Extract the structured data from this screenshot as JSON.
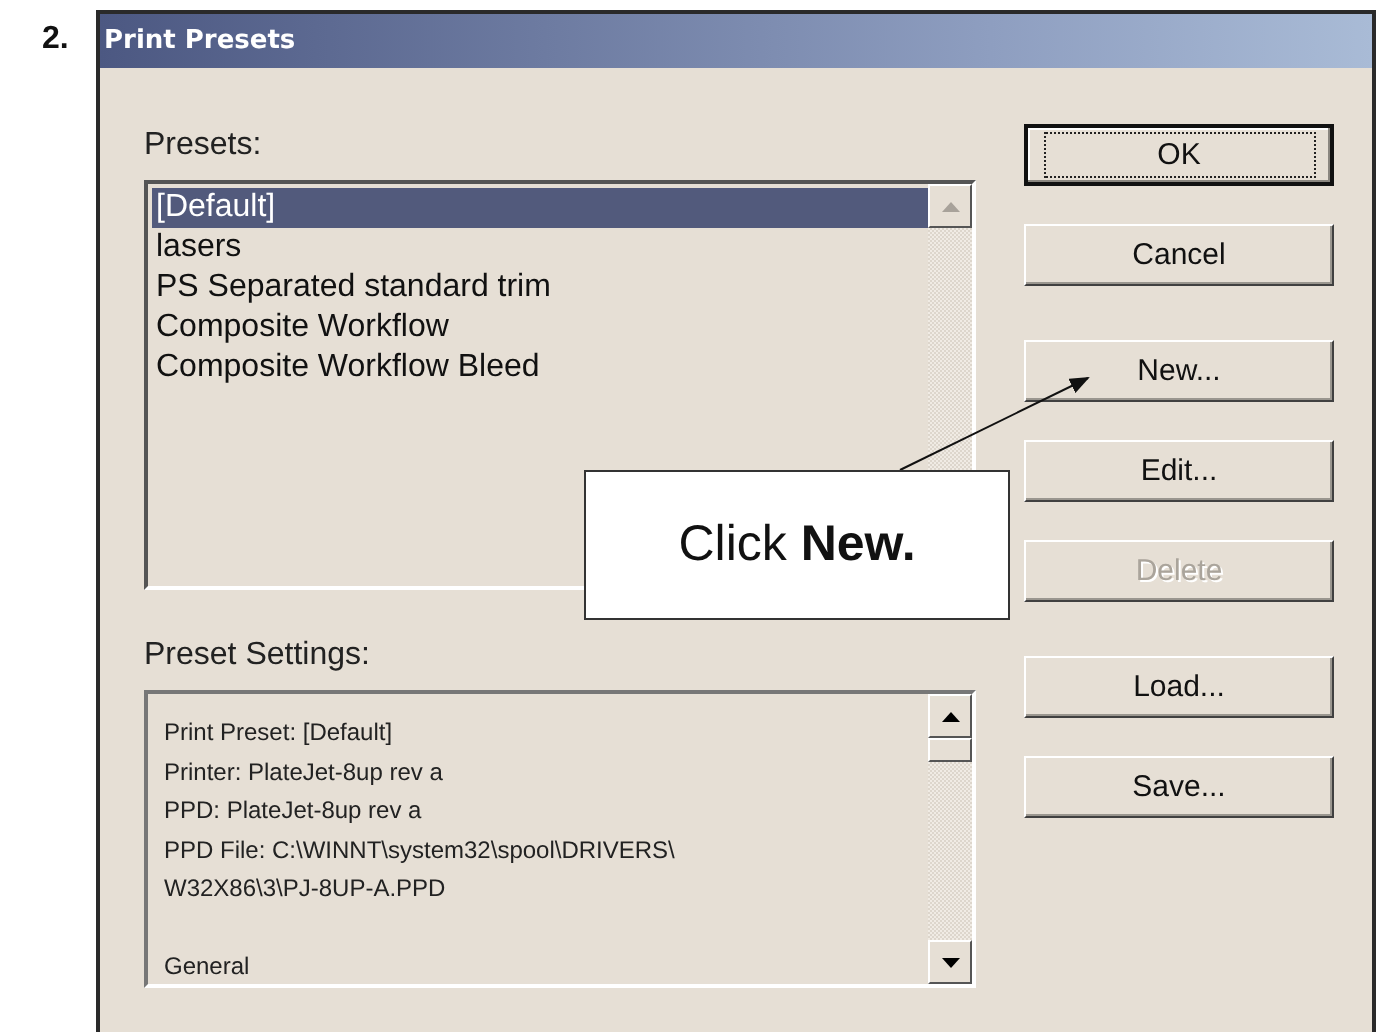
{
  "step": "2.",
  "window": {
    "title": "Print Presets"
  },
  "presets": {
    "label": "Presets:",
    "items": [
      {
        "label": "[Default]",
        "selected": true
      },
      {
        "label": "lasers",
        "selected": false
      },
      {
        "label": "PS Separated standard trim",
        "selected": false
      },
      {
        "label": "Composite Workflow",
        "selected": false
      },
      {
        "label": "Composite Workflow Bleed",
        "selected": false
      }
    ]
  },
  "settings": {
    "label": "Preset Settings:",
    "paragraphs": [
      [
        "Print Preset: [Default]",
        "Printer: PlateJet-8up rev a",
        "PPD: PlateJet-8up rev a",
        "PPD File: C:\\WINNT\\system32\\spool\\DRIVERS\\",
        "W32X86\\3\\PJ-8UP-A.PPD"
      ],
      [
        "General"
      ]
    ]
  },
  "button_groups": [
    [
      {
        "label": "OK",
        "default": true,
        "disabled": false
      },
      {
        "label": "Cancel",
        "default": false,
        "disabled": false
      }
    ],
    [
      {
        "label": "New...",
        "default": false,
        "disabled": false
      },
      {
        "label": "Edit...",
        "default": false,
        "disabled": false
      },
      {
        "label": "Delete",
        "default": false,
        "disabled": true
      }
    ],
    [
      {
        "label": "Load...",
        "default": false,
        "disabled": false
      },
      {
        "label": "Save...",
        "default": false,
        "disabled": false
      }
    ]
  ],
  "callout": {
    "text": "Click **New.**"
  }
}
